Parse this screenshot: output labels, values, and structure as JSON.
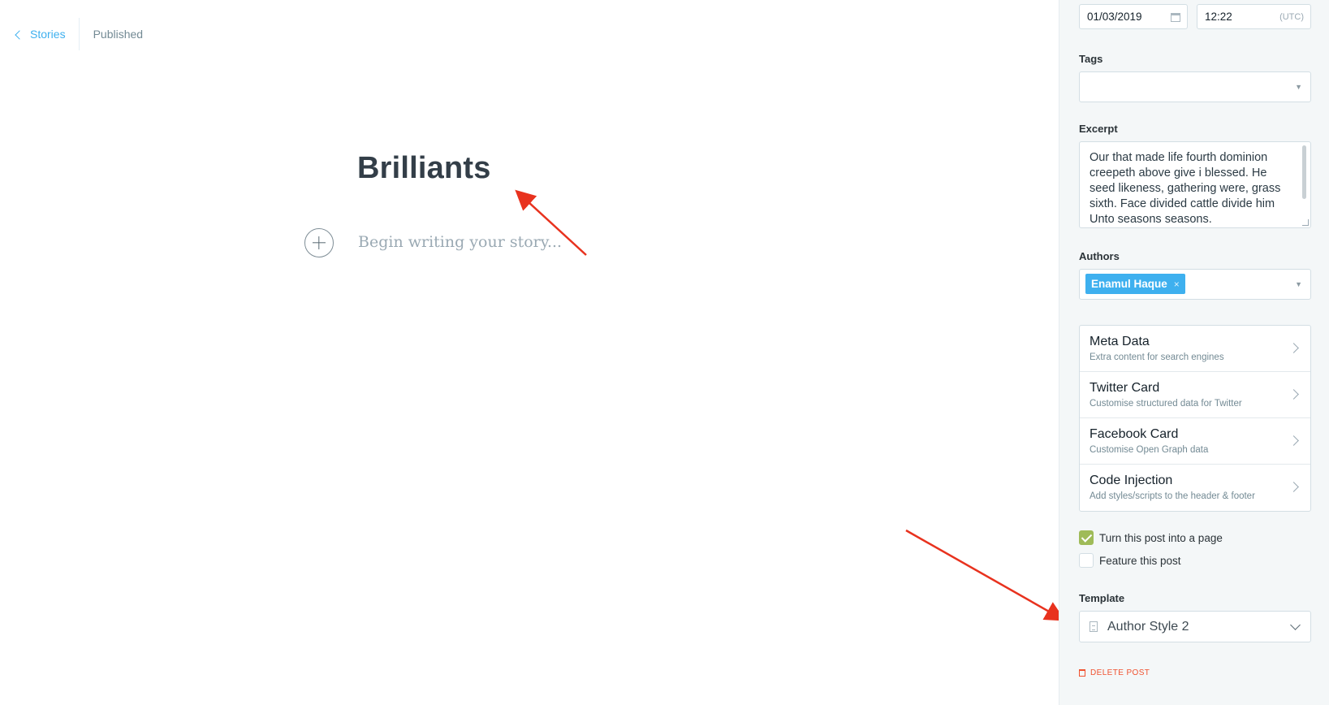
{
  "nav": {
    "back_label": "Stories",
    "status": "Published"
  },
  "editor": {
    "title": "Brilliants",
    "placeholder": "Begin writing your story..."
  },
  "settings": {
    "publish_date": "01/03/2019",
    "publish_time": "12:22",
    "timezone": "(UTC)",
    "tags_label": "Tags",
    "excerpt_label": "Excerpt",
    "excerpt_text": "Our that made life fourth dominion creepeth above give i blessed. He seed likeness, gathering were, grass sixth. Face divided cattle divide him Unto seasons seasons.",
    "authors_label": "Authors",
    "authors": [
      "Enamul Haque"
    ],
    "author_remove": "×",
    "menu": [
      {
        "title": "Meta Data",
        "subtitle": "Extra content for search engines"
      },
      {
        "title": "Twitter Card",
        "subtitle": "Customise structured data for Twitter"
      },
      {
        "title": "Facebook Card",
        "subtitle": "Customise Open Graph data"
      },
      {
        "title": "Code Injection",
        "subtitle": "Add styles/scripts to the header & footer"
      }
    ],
    "page_toggle": {
      "label": "Turn this post into a page",
      "checked": true
    },
    "feature_toggle": {
      "label": "Feature this post",
      "checked": false
    },
    "template_label": "Template",
    "template_value": "Author Style 2",
    "delete_label": "DELETE POST"
  },
  "colors": {
    "accent": "#3eb0ef",
    "danger": "#f05230",
    "checked": "#9fbb58",
    "annotation_arrow": "#e8321e"
  }
}
